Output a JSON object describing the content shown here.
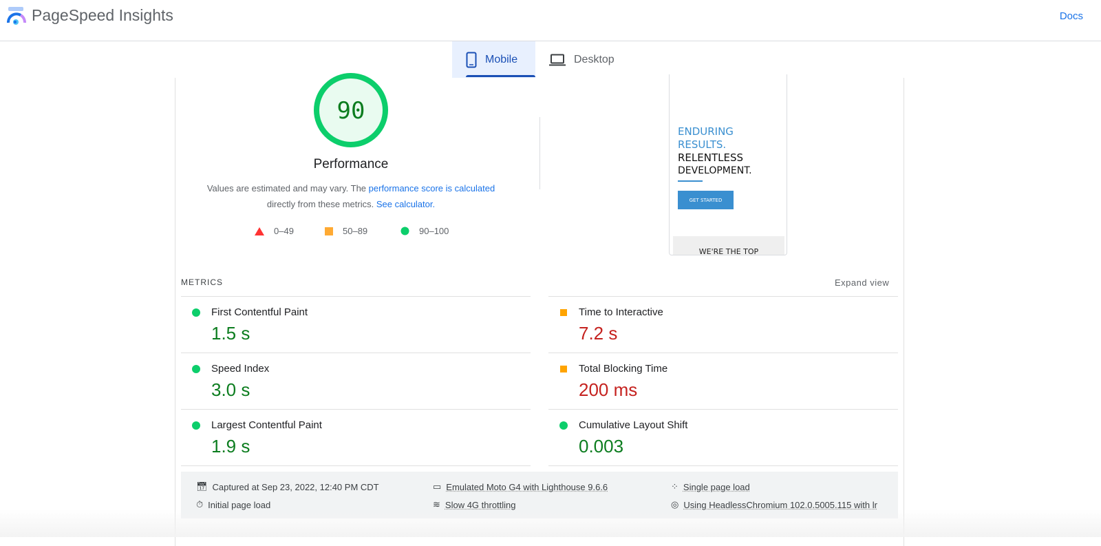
{
  "header": {
    "title": "PageSpeed Insights",
    "docs_link": "Docs"
  },
  "tabs": [
    {
      "label": "Mobile",
      "selected": true
    },
    {
      "label": "Desktop",
      "selected": false
    }
  ],
  "performance": {
    "score": "90",
    "label": "Performance",
    "desc_prefix": "Values are estimated and may vary. The ",
    "desc_link1": "performance score is calculated",
    "desc_middle": " directly from these metrics. ",
    "desc_link2": "See calculator."
  },
  "legend": [
    {
      "range": "0–49",
      "shape": "triangle",
      "color": "#ff3333"
    },
    {
      "range": "50–89",
      "shape": "square",
      "color": "#ffaa33"
    },
    {
      "range": "90–100",
      "shape": "circle",
      "color": "#0cce6b"
    }
  ],
  "screenshot": {
    "line1": "ENDURING",
    "line2": "RESULTS.",
    "line3": "RELENTLESS",
    "line4": "DEVELOPMENT.",
    "button": "GET STARTED",
    "footer": "WE'RE THE TOP"
  },
  "metrics": {
    "heading": "METRICS",
    "expand": "Expand view",
    "items": [
      {
        "label": "First Contentful Paint",
        "value": "1.5 s",
        "status": "good"
      },
      {
        "label": "Time to Interactive",
        "value": "7.2 s",
        "status": "average"
      },
      {
        "label": "Speed Index",
        "value": "3.0 s",
        "status": "good"
      },
      {
        "label": "Total Blocking Time",
        "value": "200 ms",
        "status": "average"
      },
      {
        "label": "Largest Contentful Paint",
        "value": "1.9 s",
        "status": "good"
      },
      {
        "label": "Cumulative Layout Shift",
        "value": "0.003",
        "status": "good"
      }
    ]
  },
  "footer": {
    "captured": "Captured at Sep 23, 2022, 12:40 PM CDT",
    "emulated": "Emulated Moto G4 with Lighthouse 9.6.6",
    "single": "Single page load",
    "initial": "Initial page load",
    "throttling": "Slow 4G throttling",
    "browser": "Using HeadlessChromium 102.0.5005.115 with lr"
  },
  "colors": {
    "good": "#0cce6b",
    "average": "#ffa400",
    "accent": "#1a73e8"
  }
}
